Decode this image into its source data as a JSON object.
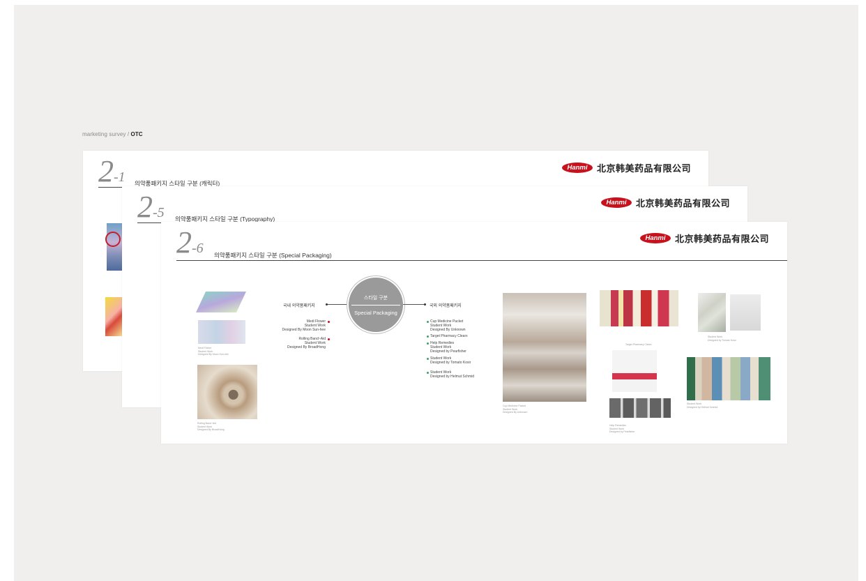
{
  "breadcrumb": {
    "section": "marketing survey",
    "separator": "/",
    "current": "OTC"
  },
  "brand": {
    "logo": "Hanmi",
    "company": "北京韩美药品有限公司",
    "logo_color": "#c7121e"
  },
  "slides": [
    {
      "number": "2",
      "sub": "-1",
      "title": "의약품패키지 스타일 구분 (캐릭터)"
    },
    {
      "number": "2",
      "sub": "-5",
      "title": "의약품패키지 스타일 구분 (Typography)"
    },
    {
      "number": "2",
      "sub": "-6",
      "title": "의약품패키지 스타일 구분 (Special Packaging)"
    }
  ],
  "diagram": {
    "center_top": "스타일 구분",
    "center_bottom": "Special Packaging",
    "left_label": "국내 의약품패키지",
    "right_label": "국외 의약품패키지",
    "left_items": [
      [
        "Medi Flower",
        "Student Work",
        "Designed By Moon Sun-hee"
      ],
      [
        "Rolling Band~Aid",
        "Student Work",
        "Designed By BroadHong"
      ]
    ],
    "right_items": [
      [
        "Cup Medicine Packet",
        "Student Work",
        "Designed By Unknown"
      ],
      [
        "Target Pharmacy Clearx"
      ],
      [
        "Help Remedies",
        "Student Work",
        "Designed by Pearfisher"
      ],
      [
        "Student Work",
        "Designed by Tomato Kosir"
      ],
      [
        "Student Work",
        "Designed by Helmut Schmid"
      ]
    ]
  },
  "captions": {
    "medi_flower": [
      "Medi Flower",
      "Student Work",
      "Designed By Moon Sun-hee"
    ],
    "rolling": [
      "Rolling Band~Aid",
      "Student Work",
      "Designed By BroadHong"
    ],
    "cup": [
      "Cup Medicine Packet",
      "Student Work",
      "Designed By Unknown"
    ],
    "target": [
      "Target Pharmacy Clearx"
    ],
    "help": [
      "Help Remedies",
      "Student Work",
      "Designed by Pearfisher"
    ],
    "tomato": [
      "Student Work",
      "Designed by Tomato Kosir"
    ],
    "helmut": [
      "Student Work",
      "Designed by Helmut Schmid"
    ]
  }
}
